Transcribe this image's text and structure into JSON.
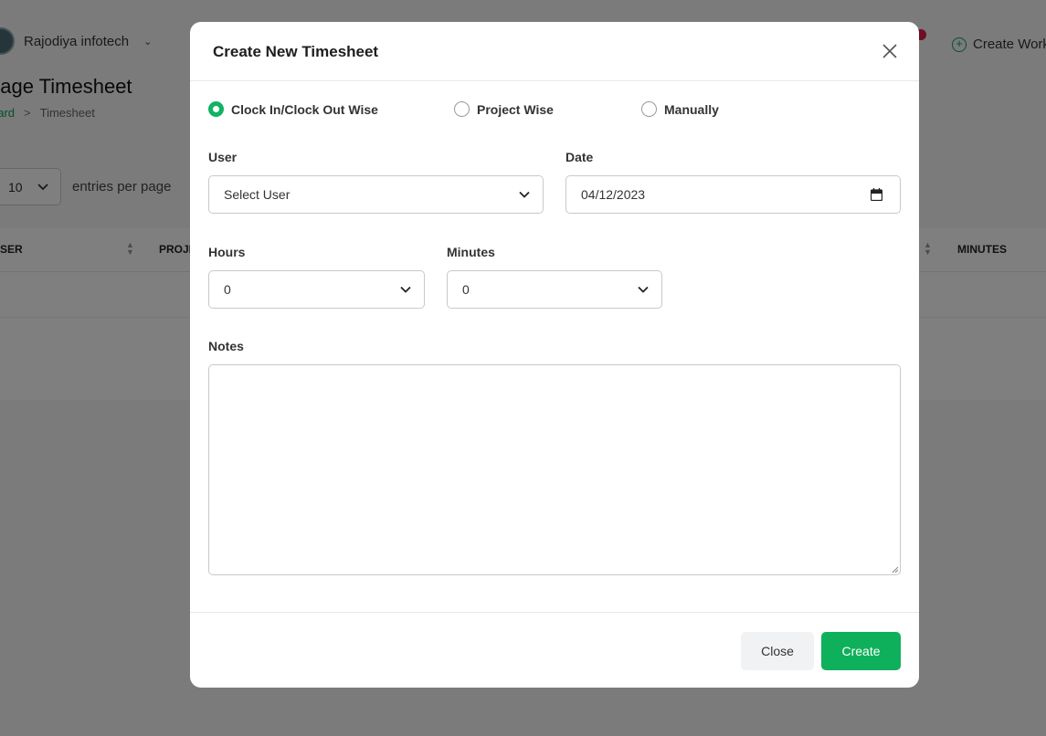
{
  "background": {
    "org_name": "Rajodiya infotech",
    "create_button_label": "Create Work",
    "page_title": "nage Timesheet",
    "breadcrumb": {
      "link": "oard",
      "separator": ">",
      "current": "Timesheet"
    },
    "entries": {
      "value": "10",
      "label": "entries per page"
    },
    "table_headers": [
      "SER",
      "PROJE",
      "MINUTES"
    ]
  },
  "modal": {
    "title": "Create New Timesheet",
    "options": [
      {
        "label": "Clock In/Clock Out Wise",
        "checked": true
      },
      {
        "label": "Project Wise",
        "checked": false
      },
      {
        "label": "Manually",
        "checked": false
      }
    ],
    "user": {
      "label": "User",
      "value": "Select User"
    },
    "date": {
      "label": "Date",
      "value": "04/12/2023"
    },
    "hours": {
      "label": "Hours",
      "value": "0"
    },
    "minutes": {
      "label": "Minutes",
      "value": "0"
    },
    "notes": {
      "label": "Notes",
      "value": ""
    },
    "buttons": {
      "close": "Close",
      "create": "Create"
    }
  },
  "colors": {
    "accent": "#0fb05c",
    "badge": "#e11d48"
  }
}
